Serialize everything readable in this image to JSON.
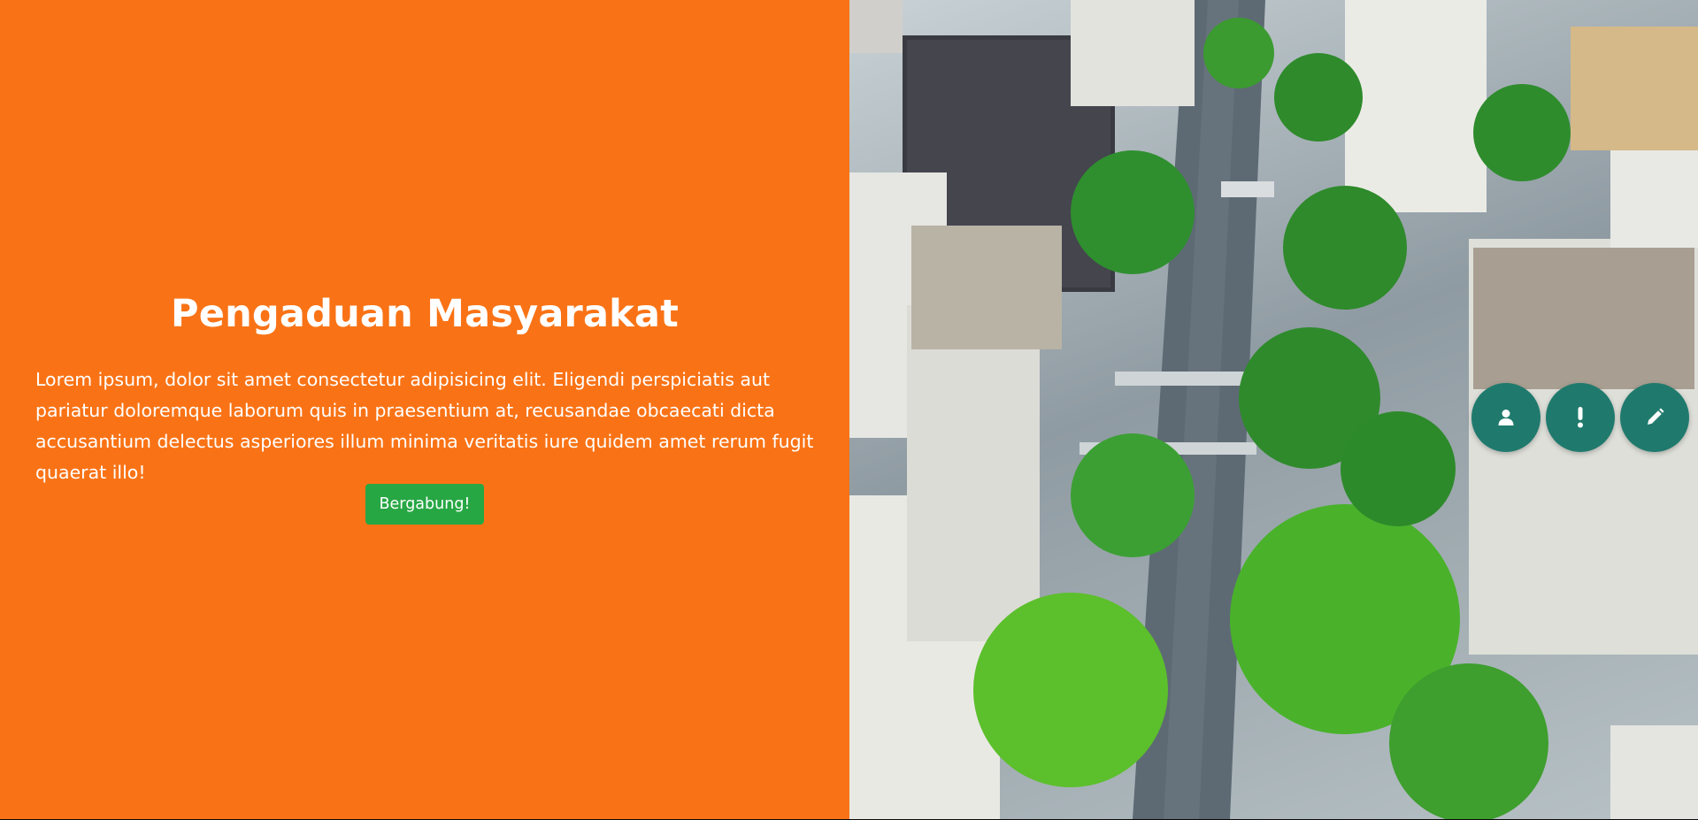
{
  "hero": {
    "title": "Pengaduan Masyarakat",
    "description": "Lorem ipsum, dolor sit amet consectetur adipisicing elit. Eligendi perspiciatis aut pariatur doloremque laborum quis in praesentium at, recusandae obcaecati dicta accusantium delectus asperiores illum minima veritatis iure quidem amet rerum fugit quaerat illo!",
    "button_label": "Bergabung!"
  },
  "colors": {
    "hero_background": "#f97316",
    "button_background": "#27a744",
    "fab_background": "#1f7a6d"
  },
  "floating_actions": [
    {
      "icon": "user-icon"
    },
    {
      "icon": "exclamation-icon"
    },
    {
      "icon": "pencil-icon"
    }
  ]
}
